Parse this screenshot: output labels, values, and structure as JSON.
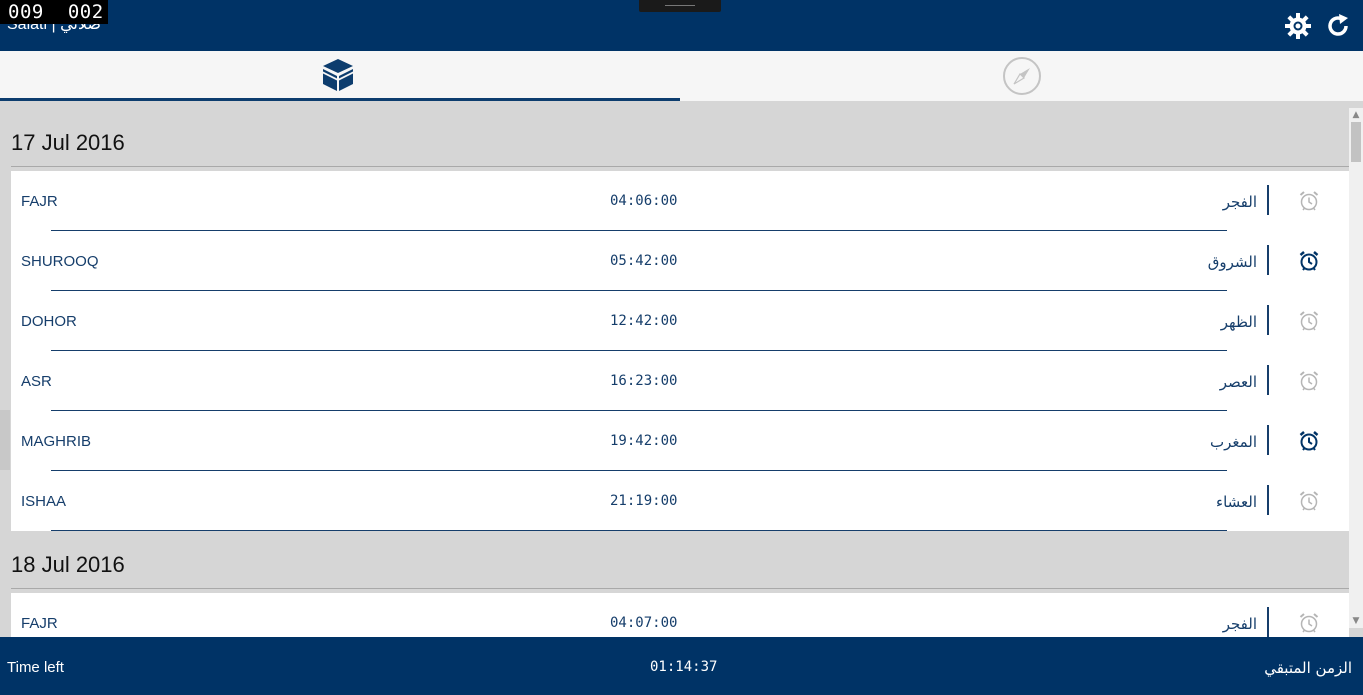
{
  "frame_counter": {
    "left": "009",
    "right": "002"
  },
  "app": {
    "title": "Salati | صلاتي"
  },
  "days": [
    {
      "date": "17 Jul 2016",
      "prayers": [
        {
          "name": "FAJR",
          "time": "04:06:00",
          "arabic": "الفجر",
          "alarm_on": false
        },
        {
          "name": "SHUROOQ",
          "time": "05:42:00",
          "arabic": "الشروق",
          "alarm_on": true
        },
        {
          "name": "DOHOR",
          "time": "12:42:00",
          "arabic": "الظهر",
          "alarm_on": false
        },
        {
          "name": "ASR",
          "time": "16:23:00",
          "arabic": "العصر",
          "alarm_on": false
        },
        {
          "name": "MAGHRIB",
          "time": "19:42:00",
          "arabic": "المغرب",
          "alarm_on": true
        },
        {
          "name": "ISHAA",
          "time": "21:19:00",
          "arabic": "العشاء",
          "alarm_on": false
        }
      ]
    },
    {
      "date": "18 Jul 2016",
      "prayers": [
        {
          "name": "FAJR",
          "time": "04:07:00",
          "arabic": "الفجر",
          "alarm_on": false
        }
      ]
    }
  ],
  "footer": {
    "left_label": "Time left",
    "time_left": "01:14:37",
    "right_label": "الزمن المتبقي"
  },
  "colors": {
    "brand": "#003366",
    "text": "#163e6b",
    "alarm_off": "#b5b5b5"
  },
  "icons": {
    "settings": "gear-icon",
    "refresh": "refresh-icon",
    "tab1": "kaaba-icon",
    "tab2": "compass-icon",
    "alarm": "alarm-clock-icon"
  }
}
